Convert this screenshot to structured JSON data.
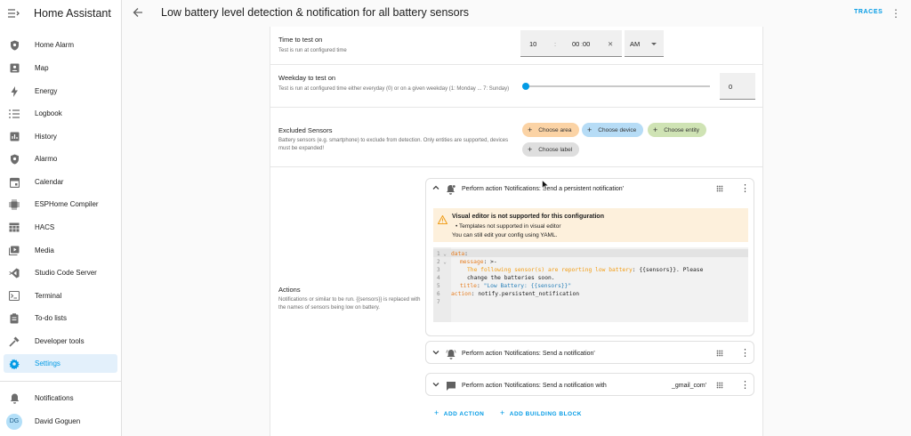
{
  "app_title": "Home Assistant",
  "page_title": "Low battery level detection & notification for all battery sensors",
  "traces_label": "TRACES",
  "sidebar": {
    "items": [
      {
        "label": "Home Alarm",
        "icon": "shield-icon"
      },
      {
        "label": "Map",
        "icon": "map-icon"
      },
      {
        "label": "Energy",
        "icon": "lightning-icon"
      },
      {
        "label": "Logbook",
        "icon": "list-icon"
      },
      {
        "label": "History",
        "icon": "chart-icon"
      },
      {
        "label": "Alarmo",
        "icon": "shield-icon"
      },
      {
        "label": "Calendar",
        "icon": "calendar-icon"
      },
      {
        "label": "ESPHome Compiler",
        "icon": "chip-icon"
      },
      {
        "label": "HACS",
        "icon": "hacs-icon"
      },
      {
        "label": "Media",
        "icon": "media-icon"
      },
      {
        "label": "Studio Code Server",
        "icon": "vscode-icon"
      },
      {
        "label": "Terminal",
        "icon": "terminal-icon"
      },
      {
        "label": "To-do lists",
        "icon": "clipboard-icon"
      },
      {
        "label": "Developer tools",
        "icon": "hammer-icon"
      },
      {
        "label": "Settings",
        "icon": "gear-icon"
      }
    ],
    "notifications_label": "Notifications",
    "user_initials": "DG",
    "user_name": "David Goguen",
    "active_color": "#039be5"
  },
  "time_test": {
    "title": "Time to test on",
    "description": "Test is run at configured time",
    "hours": "10",
    "minutes": "00",
    "seconds": "00",
    "separator": ":",
    "clear_symbol": "✕",
    "ampm": "AM"
  },
  "weekday_test": {
    "title": "Weekday to test on",
    "description": "Test is run at configured time either everyday (0) or on a given weekday (1: Monday ... 7: Sunday)",
    "value": "0",
    "slider_fraction": 0
  },
  "excluded": {
    "title": "Excluded Sensors",
    "description": "Battery sensors (e.g. smartphone) to exclude from detection. Only entities are supported, devices must be expanded!",
    "chips": {
      "area": "Choose area",
      "device": "Choose device",
      "entity": "Choose entity",
      "label": "Choose label"
    }
  },
  "actions": {
    "title": "Actions",
    "description": "Notifications or similar to be run. {{sensors}} is replaced with the names of sensors being low on battery.",
    "action1_title": "Perform action 'Notifications: Send a persistent notification'",
    "warning_title": "Visual editor is not supported for this configuration",
    "warning_bullet": "• Templates not supported in visual editor",
    "warning_note": "You can still edit your config using YAML.",
    "code": {
      "ln1": "1",
      "ln2": "2",
      "ln3": "3",
      "ln4": "4",
      "ln5": "5",
      "ln6": "6",
      "ln7": "7",
      "l1_key": "data",
      "l1_rest": ":",
      "l2_key": "message",
      "l2_rest": ": >-",
      "l3": "The following sensor(s) are reporting low battery",
      "l3_rest": ": {{sensors}}. Please",
      "l4": "change the batteries soon.",
      "l5_key": "title",
      "l5_rest": ": ",
      "l5_val": "\"Low Battery: {{sensors}}\"",
      "l6_key": "action",
      "l6_rest": ": notify.persistent_notification",
      "fold1": "1 ⌄",
      "fold2": "2 ⌄"
    },
    "action2_title": "Perform action 'Notifications: Send a notification'",
    "action3_title": "Perform action 'Notifications: Send a notification with",
    "action3_suffix": "_gmail_com'",
    "add_action": "ADD ACTION",
    "add_block": "ADD BUILDING BLOCK"
  }
}
